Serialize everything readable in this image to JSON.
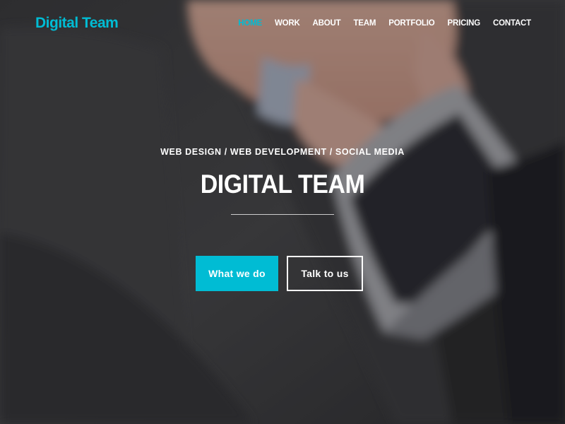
{
  "colors": {
    "accent": "#00bcd4",
    "text": "#ffffff"
  },
  "navbar": {
    "brand": "Digital Team",
    "links": [
      {
        "label": "HOME",
        "active": true
      },
      {
        "label": "WORK",
        "active": false
      },
      {
        "label": "ABOUT",
        "active": false
      },
      {
        "label": "TEAM",
        "active": false
      },
      {
        "label": "PORTFOLIO",
        "active": false
      },
      {
        "label": "PRICING",
        "active": false
      },
      {
        "label": "CONTACT",
        "active": false
      }
    ]
  },
  "hero": {
    "tagline": "WEB DESIGN / WEB DEVELOPMENT / SOCIAL MEDIA",
    "title": "DIGITAL TEAM",
    "primary_button": "What we do",
    "secondary_button": "Talk to us"
  }
}
